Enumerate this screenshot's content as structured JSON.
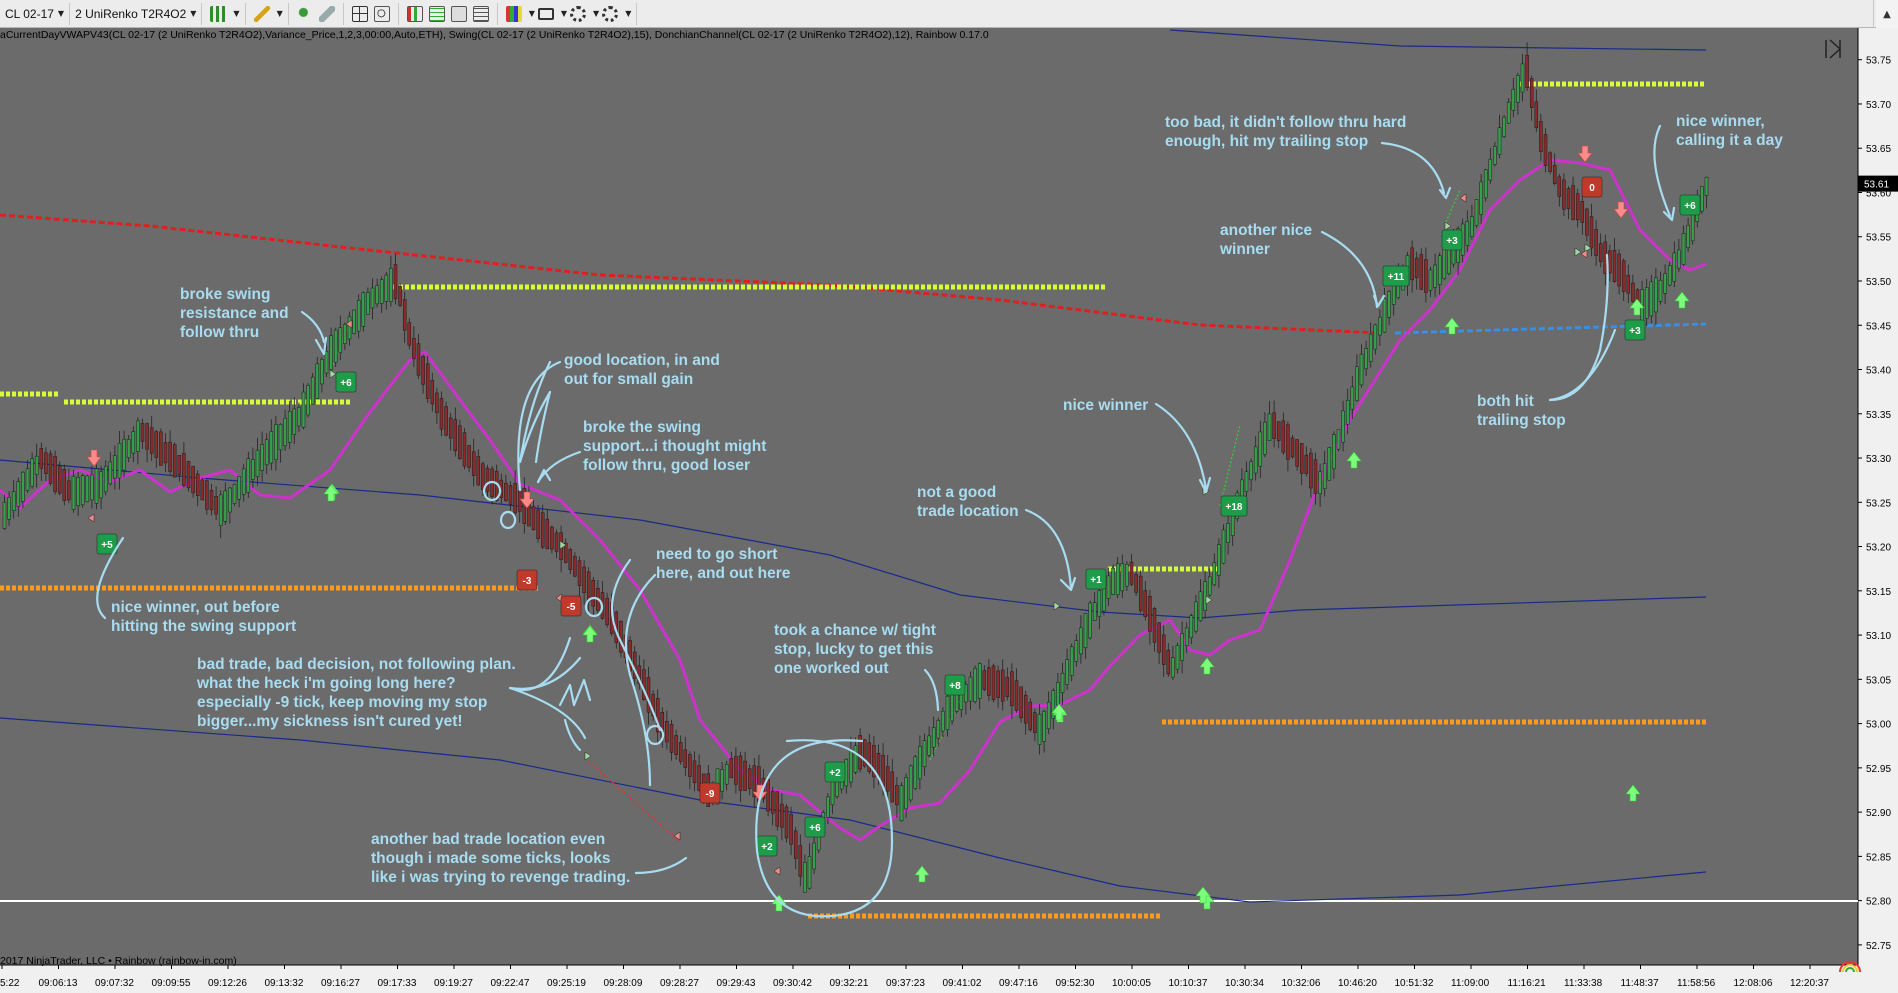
{
  "toolbar": {
    "instrument": "CL 02-17",
    "bar_type": "2 UniRenko T2R4O2",
    "scroll_up": "▲"
  },
  "indicators_text": "aCurrentDayVWAPV43(CL 02-17 (2 UniRenko T2R4O2),Variance_Price,1,2,3,00:00,Auto,ETH), Swing(CL 02-17 (2 UniRenko T2R4O2),15), DonchianChannel(CL 02-17 (2 UniRenko T2R4O2),12), Rainbow 0.17.0",
  "copyright": "2017 NinjaTrader, LLC • Rainbow (rainbow-in.com)",
  "colors": {
    "background": "#6b6b6b",
    "up_candle": "#37a14a",
    "down_candle": "#8a2b2b",
    "rainbow_line": "#cc33cc",
    "vwap_red": "#e02020",
    "vwap_blue": "#1a2a8a",
    "donchian_high": "#d6ff3a",
    "donchian_low": "#ff9a1a",
    "annotation": "#a8dcf0",
    "badge_win": "#1e9c4a",
    "badge_loss": "#c0392b"
  },
  "chart_data": {
    "type": "candlestick",
    "symbol": "CL 02-17",
    "ylim": [
      52.75,
      53.77
    ],
    "y_ticks": [
      "53.75",
      "53.70",
      "53.65",
      "53.60",
      "53.55",
      "53.50",
      "53.45",
      "53.40",
      "53.35",
      "53.30",
      "53.25",
      "53.20",
      "53.15",
      "53.10",
      "53.05",
      "53.00",
      "52.95",
      "52.90",
      "52.85",
      "52.80",
      "52.75"
    ],
    "last_price": "53.61",
    "x_ticks": [
      "5:22",
      "09:06:13",
      "09:07:32",
      "09:09:55",
      "09:12:26",
      "09:13:32",
      "09:16:27",
      "09:17:33",
      "09:19:27",
      "09:22:47",
      "09:25:19",
      "09:28:09",
      "09:28:27",
      "09:29:43",
      "09:30:42",
      "09:32:21",
      "09:37:23",
      "09:41:02",
      "09:47:16",
      "09:52:30",
      "10:00:05",
      "10:10:37",
      "10:30:34",
      "10:32:06",
      "10:46:20",
      "10:51:32",
      "11:09:00",
      "11:16:21",
      "11:33:38",
      "11:48:37",
      "11:58:56",
      "12:08:06",
      "12:20:37"
    ],
    "trades": [
      {
        "label": "+6",
        "result": "win"
      },
      {
        "label": "+5",
        "result": "win"
      },
      {
        "label": "-3",
        "result": "loss"
      },
      {
        "label": "-5",
        "result": "loss"
      },
      {
        "label": "-9",
        "result": "loss"
      },
      {
        "label": "+2",
        "result": "win"
      },
      {
        "label": "+6",
        "result": "win"
      },
      {
        "label": "+2",
        "result": "win"
      },
      {
        "label": "+8",
        "result": "win"
      },
      {
        "label": "+1",
        "result": "win"
      },
      {
        "label": "+18",
        "result": "win"
      },
      {
        "label": "+11",
        "result": "win"
      },
      {
        "label": "+3",
        "result": "win"
      },
      {
        "label": "0",
        "result": "loss"
      },
      {
        "label": "+3",
        "result": "win"
      },
      {
        "label": "+6",
        "result": "win"
      }
    ],
    "annotations": [
      {
        "lines": [
          "broke swing",
          "resistance and",
          "follow thru"
        ]
      },
      {
        "lines": [
          "good location, in and",
          "out for small gain"
        ]
      },
      {
        "lines": [
          "broke the swing",
          "support...i thought might",
          "follow thru, good loser"
        ]
      },
      {
        "lines": [
          "need to go short",
          "here, and out here"
        ]
      },
      {
        "lines": [
          "nice winner, out before",
          "hitting the swing support"
        ]
      },
      {
        "lines": [
          "bad trade, bad decision, not following plan.",
          "what the heck i'm going long here?",
          "especially -9 tick, keep moving my stop",
          "bigger...my sickness isn't cured yet!"
        ]
      },
      {
        "lines": [
          "took a chance w/ tight",
          "stop, lucky to get this",
          "one worked out"
        ]
      },
      {
        "lines": [
          "another bad trade location even",
          "though i made some ticks, looks",
          "like i was trying to revenge trading."
        ]
      },
      {
        "lines": [
          "not a good",
          "trade location"
        ]
      },
      {
        "lines": [
          "nice winner"
        ]
      },
      {
        "lines": [
          "too bad, it didn't follow thru hard",
          "enough, hit my trailing stop"
        ]
      },
      {
        "lines": [
          "another nice",
          "winner"
        ]
      },
      {
        "lines": [
          "nice winner,",
          "calling it a day"
        ]
      },
      {
        "lines": [
          "both hit",
          "trailing stop"
        ]
      }
    ]
  }
}
